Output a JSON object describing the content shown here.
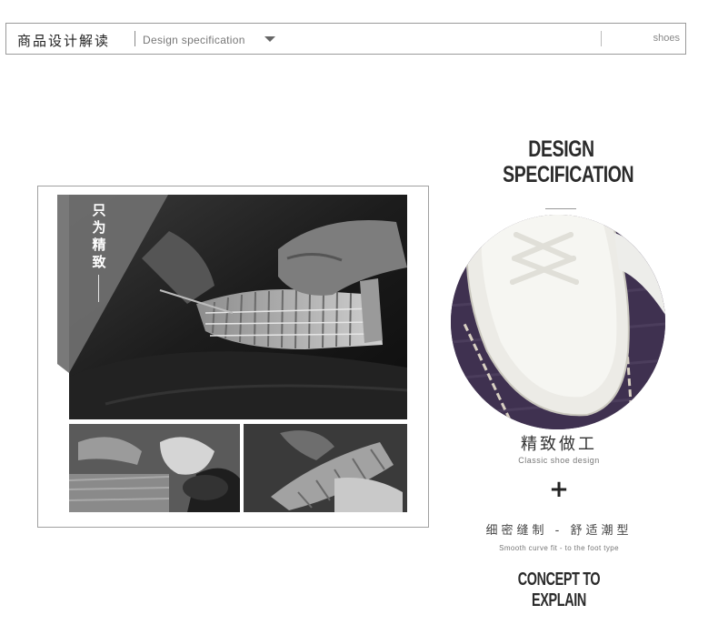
{
  "header": {
    "title_cn": "商品设计解读",
    "title_en": "Design  specification",
    "dropdown_icon": "triangle-down-icon",
    "category": "shoes"
  },
  "gallery": {
    "tag": "只为精致"
  },
  "spec": {
    "title_line1": "DESIGN",
    "title_line2": "SPECIFICATION",
    "craft_cn": "精致做工",
    "craft_en": "Classic  shoe  design",
    "plus": "+",
    "sew_cn": "细密缝制 - 舒适潮型",
    "sew_en": "Smooth  curve  fit  -  to  the  foot  type",
    "concept": "CONCEPT TO EXPLAIN"
  },
  "colors": {
    "border": "#9a9a9a",
    "text_dark": "#2b2b2b",
    "purple_bg": "#3d2f4d"
  }
}
